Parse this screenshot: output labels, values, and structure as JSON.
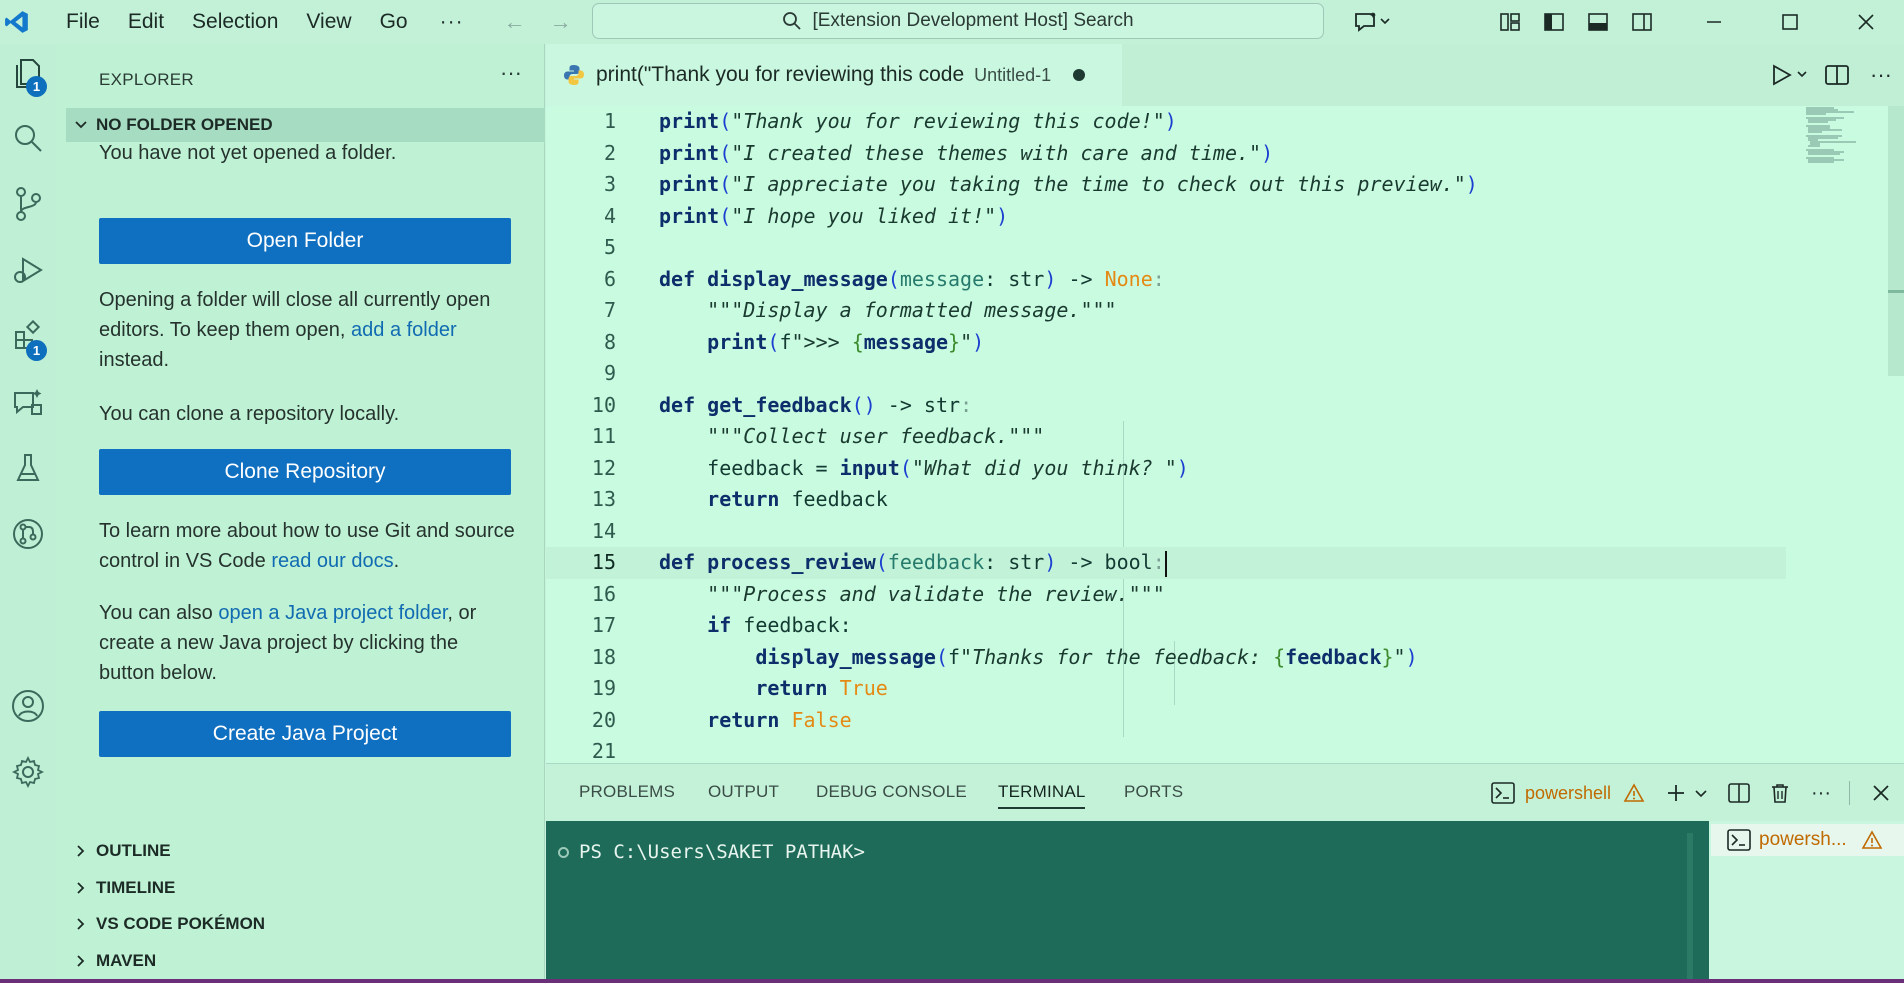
{
  "titlebar": {
    "menu": [
      "File",
      "Edit",
      "Selection",
      "View",
      "Go"
    ],
    "more": "···",
    "search": "[Extension Development Host] Search"
  },
  "activity": {
    "explorer_badge": "1",
    "extensions_badge": "1"
  },
  "sidebar": {
    "title": "EXPLORER",
    "more": "···",
    "section": "NO FOLDER OPENED",
    "msg_no_folder": "You have not yet opened a folder.",
    "open_folder": "Open Folder",
    "msg_opening_1": "Opening a folder will close all currently open editors. To keep them open, ",
    "link_add_folder": "add a folder",
    "msg_opening_2": " instead.",
    "msg_clone": "You can clone a repository locally.",
    "clone_repo": "Clone Repository",
    "msg_git_1": "To learn more about how to use Git and source control in VS Code ",
    "link_docs": "read our docs",
    "msg_git_2": ".",
    "msg_java_1": "You can also ",
    "link_java": "open a Java project folder",
    "msg_java_2": ", or create a new Java project by clicking the button below.",
    "create_java": "Create Java Project",
    "bottom_sections": [
      "OUTLINE",
      "TIMELINE",
      "VS CODE POKÉMON",
      "MAVEN"
    ]
  },
  "editor": {
    "tab_title": "print(\"Thank you for reviewing this code",
    "tab_desc": "Untitled-1",
    "line_numbers": [
      "1",
      "2",
      "3",
      "4",
      "5",
      "6",
      "7",
      "8",
      "9",
      "10",
      "11",
      "12",
      "13",
      "14",
      "15",
      "16",
      "17",
      "18",
      "19",
      "20",
      "21"
    ],
    "current_line": 15
  },
  "panel": {
    "tabs": [
      "PROBLEMS",
      "OUTPUT",
      "DEBUG CONSOLE",
      "TERMINAL",
      "PORTS"
    ],
    "active_tab": "TERMINAL",
    "shell": "powershell",
    "prompt": "PS C:\\Users\\SAKET PATHAK>",
    "terminal_item": "powersh..."
  },
  "colors": {
    "accent_button": "#0f6fc0",
    "badge": "#0e6fbd",
    "terminal_bg": "#1d6b58",
    "editor_bg": "#c9fbe0",
    "keyword_constant": "#e48a14"
  }
}
